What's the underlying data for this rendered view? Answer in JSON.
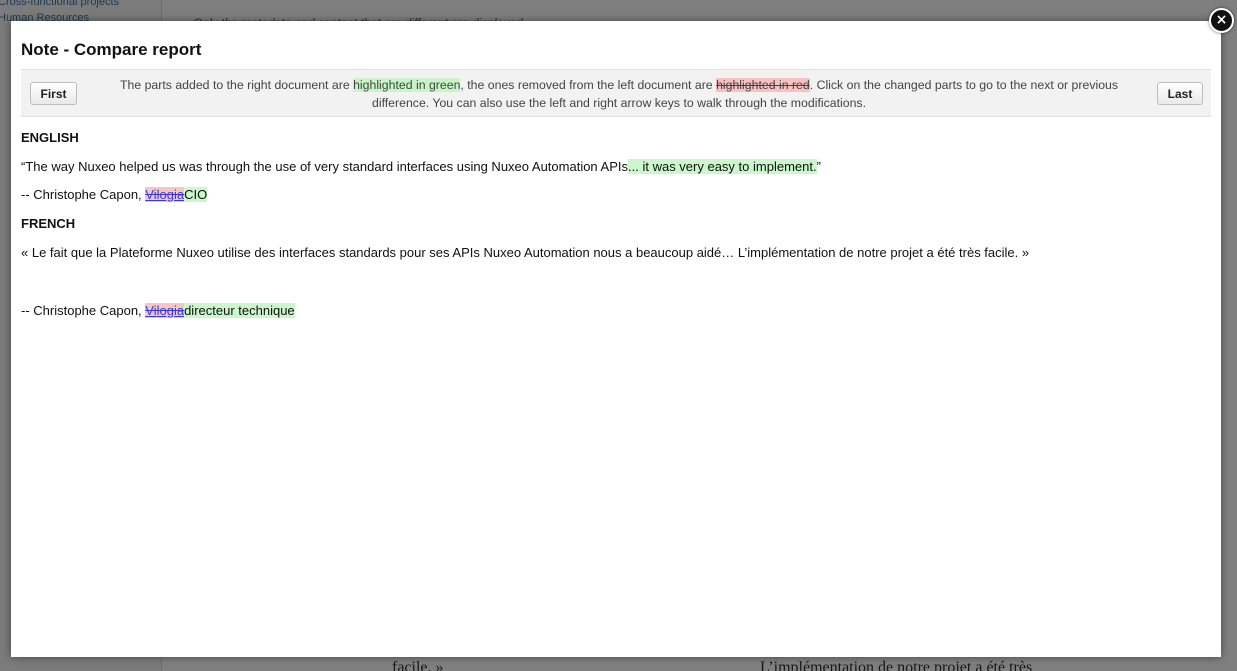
{
  "background": {
    "sidebar_links": [
      "Cross-functional projects",
      "Human Resources"
    ],
    "main_note": "Only the metadata and content that are different are displayed",
    "bottom_left_text": "facile. »",
    "bottom_right_text": "L’implémentation de notre projet a été très"
  },
  "dialog": {
    "title": "Note - Compare report",
    "close_label": "×",
    "first_button": "First",
    "last_button": "Last",
    "info": {
      "part1": "The parts added to the right document are ",
      "added_sample": "highlighted in green",
      "part2": ", the ones removed from the left document are ",
      "removed_sample": "highlighted in red",
      "part3": ". Click on the changed parts to go to the next or previous difference. You can also use the left and right arrow keys to walk through the modifications."
    },
    "content": {
      "english_heading": "ENGLISH",
      "english_quote": "“The way Nuxeo helped us was through the use of very standard interfaces using Nuxeo Automation APIs",
      "english_quote_added": "... it was very easy to implement.",
      "english_quote_end": "”",
      "english_attribution": "-- Christophe Capon, ",
      "english_removed": "Vilogia",
      "english_added": "CIO",
      "french_heading": "FRENCH",
      "french_quote": "« Le fait que la Plateforme Nuxeo utilise des interfaces standards pour ses APIs Nuxeo Automation nous a beaucoup aidé… L’implémentation de notre projet a été très facile. »",
      "french_attribution": "-- Christophe Capon, ",
      "french_removed": "Vilogia",
      "french_added": "directeur technique"
    },
    "colors": {
      "added": "#ccf6cc",
      "removed": "#f5c6c6"
    }
  }
}
